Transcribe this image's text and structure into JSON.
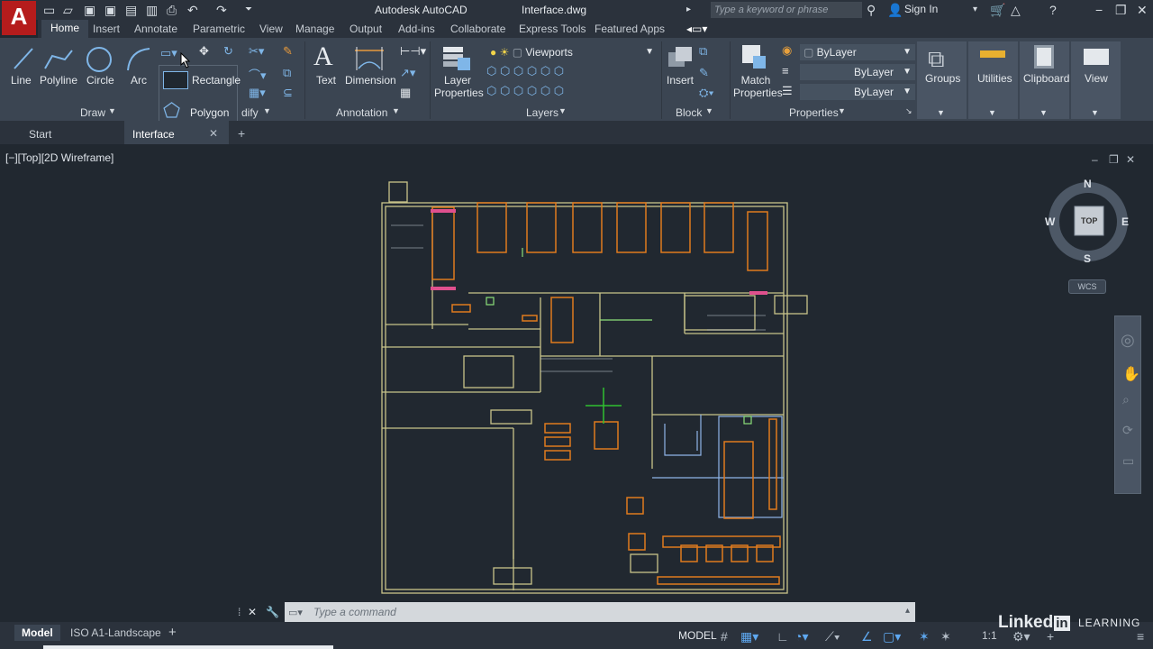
{
  "app": {
    "name": "Autodesk AutoCAD",
    "file": "Interface.dwg",
    "logo": "A"
  },
  "search": {
    "placeholder": "Type a keyword or phrase"
  },
  "account": {
    "signin": "Sign In"
  },
  "ribbon_tabs": [
    "Home",
    "Insert",
    "Annotate",
    "Parametric",
    "View",
    "Manage",
    "Output",
    "Add-ins",
    "Collaborate",
    "Express Tools",
    "Featured Apps"
  ],
  "draw": {
    "tools": [
      "Line",
      "Polyline",
      "Circle",
      "Arc"
    ],
    "title": "Draw",
    "flyout": [
      "Rectangle",
      "Polygon"
    ]
  },
  "modify": {
    "title_fragment": "dify"
  },
  "annotation": {
    "tools": [
      "Text",
      "Dimension"
    ],
    "title": "Annotation"
  },
  "layers": {
    "tool": "Layer Properties",
    "title": "Layers",
    "current_layer": "Viewports"
  },
  "block": {
    "tool": "Insert",
    "title": "Block"
  },
  "properties": {
    "tool": "Match Properties",
    "title": "Properties",
    "bylayer": [
      "ByLayer",
      "ByLayer",
      "ByLayer"
    ]
  },
  "right_panels": [
    "Groups",
    "Utilities",
    "Clipboard",
    "View"
  ],
  "file_tabs": {
    "start": "Start",
    "current": "Interface",
    "add": "+"
  },
  "viewport": {
    "label": "[−][Top][2D Wireframe]"
  },
  "viewcube": {
    "n": "N",
    "s": "S",
    "e": "E",
    "w": "W",
    "top": "TOP",
    "wcs": "WCS"
  },
  "command": {
    "placeholder": "Type  a  command"
  },
  "layouts": [
    "Model",
    "ISO A1-Landscape"
  ],
  "status": {
    "model": "MODEL",
    "scale": "1:1"
  },
  "watermark": {
    "brand": "Linked",
    "in": "in",
    "learning": "LEARNING"
  },
  "colors": {
    "background": "#212830",
    "ribbon": "#3b4552",
    "accent_logo": "#b51c1c",
    "walls": "#c8c48a",
    "furniture": "#e07a1e"
  }
}
